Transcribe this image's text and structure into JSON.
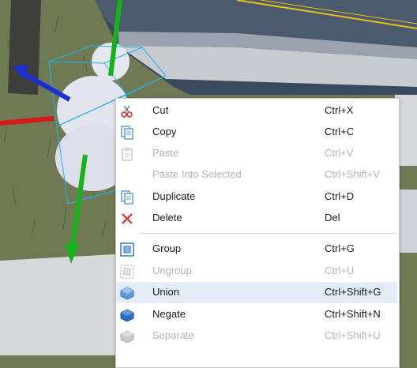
{
  "context_menu": {
    "items": [
      {
        "label": "Cut",
        "shortcut": "Ctrl+X",
        "icon": "scissors-icon",
        "enabled": true
      },
      {
        "label": "Copy",
        "shortcut": "Ctrl+C",
        "icon": "copy-icon",
        "enabled": true
      },
      {
        "label": "Paste",
        "shortcut": "Ctrl+V",
        "icon": "paste-icon",
        "enabled": false
      },
      {
        "label": "Paste Into Selected",
        "shortcut": "Ctrl+Shift+V",
        "icon": "",
        "enabled": false
      },
      {
        "label": "Duplicate",
        "shortcut": "Ctrl+D",
        "icon": "duplicate-icon",
        "enabled": true
      },
      {
        "label": "Delete",
        "shortcut": "Del",
        "icon": "delete-x-icon",
        "enabled": true
      },
      {
        "label": "Group",
        "shortcut": "Ctrl+G",
        "icon": "group-icon",
        "enabled": true
      },
      {
        "label": "Ungroup",
        "shortcut": "Ctrl+U",
        "icon": "ungroup-icon",
        "enabled": false
      },
      {
        "label": "Union",
        "shortcut": "Ctrl+Shift+G",
        "icon": "union-icon",
        "enabled": true,
        "highlighted": true
      },
      {
        "label": "Negate",
        "shortcut": "Ctrl+Shift+N",
        "icon": "negate-icon",
        "enabled": true
      },
      {
        "label": "Separate",
        "shortcut": "Ctrl+Shift+U",
        "icon": "separate-icon",
        "enabled": false
      }
    ]
  },
  "colors": {
    "grass": "#6f7a55",
    "road": "#3a4a5c",
    "road_line": "#e8c21a",
    "sidewalk": "#d7d9dc",
    "menu_highlight": "#e3ecf7",
    "delete_red": "#e0332b",
    "axis_green": "#17b21a",
    "axis_red": "#d21a1a",
    "axis_blue": "#1a2fd4",
    "selection_box": "#1fb3e8"
  }
}
